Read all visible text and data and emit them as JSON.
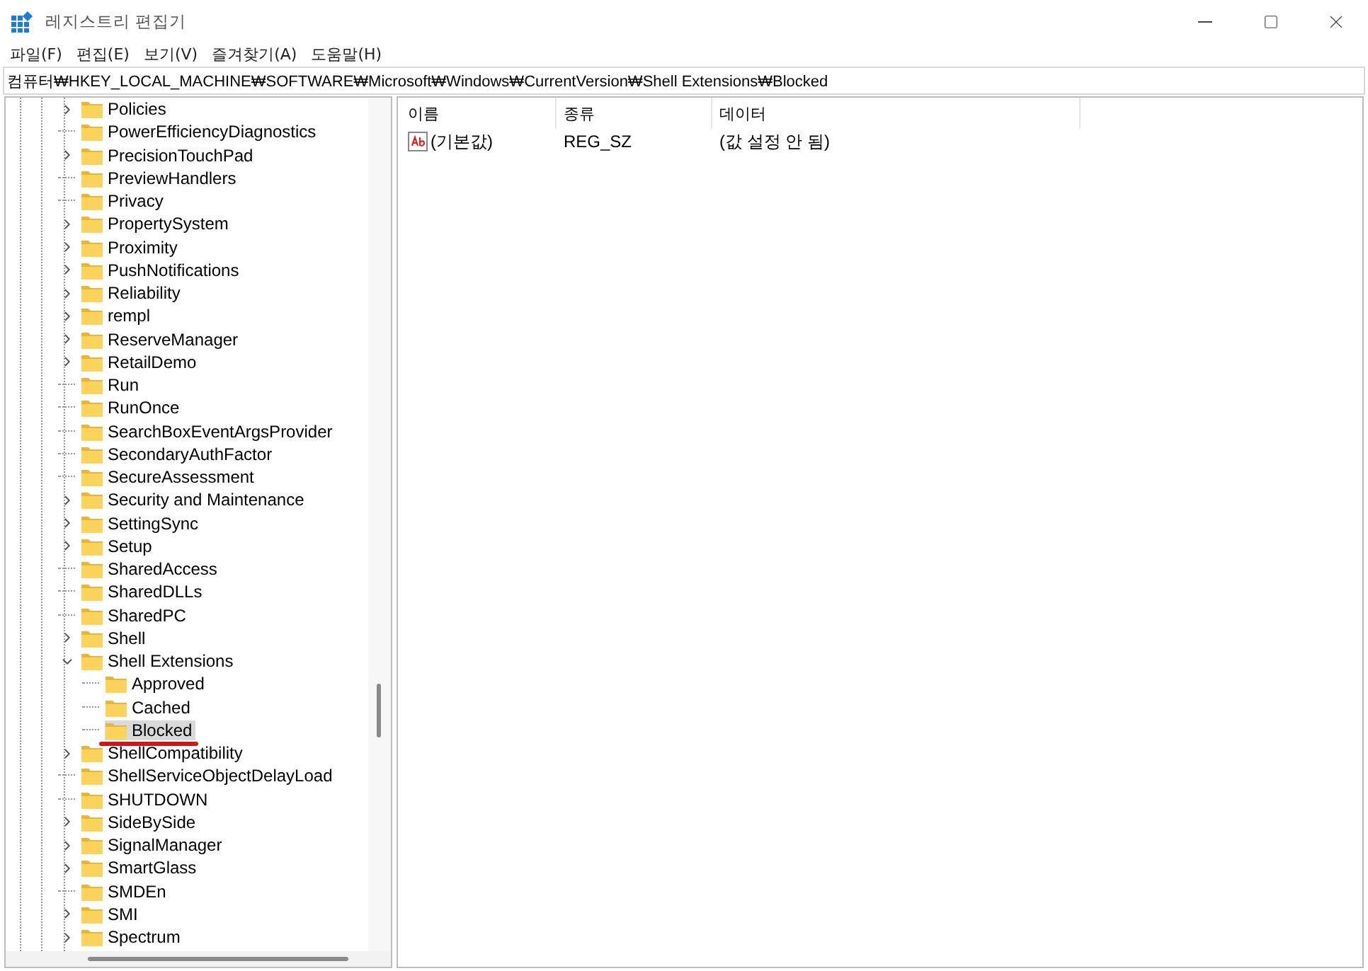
{
  "window": {
    "title": "레지스트리 편집기"
  },
  "menu": [
    "파일(F)",
    "편집(E)",
    "보기(V)",
    "즐겨찾기(A)",
    "도움말(H)"
  ],
  "address": "컴퓨터₩HKEY_LOCAL_MACHINE₩SOFTWARE₩Microsoft₩Windows₩CurrentVersion₩Shell Extensions₩Blocked",
  "tree": [
    {
      "label": "Policies",
      "kind": "branch",
      "expanded": false,
      "selected": false
    },
    {
      "label": "PowerEfficiencyDiagnostics",
      "kind": "leaf",
      "selected": false
    },
    {
      "label": "PrecisionTouchPad",
      "kind": "branch",
      "expanded": false,
      "selected": false
    },
    {
      "label": "PreviewHandlers",
      "kind": "leaf",
      "selected": false
    },
    {
      "label": "Privacy",
      "kind": "leaf",
      "selected": false
    },
    {
      "label": "PropertySystem",
      "kind": "branch",
      "expanded": false,
      "selected": false
    },
    {
      "label": "Proximity",
      "kind": "branch",
      "expanded": false,
      "selected": false
    },
    {
      "label": "PushNotifications",
      "kind": "branch",
      "expanded": false,
      "selected": false
    },
    {
      "label": "Reliability",
      "kind": "branch",
      "expanded": false,
      "selected": false
    },
    {
      "label": "rempl",
      "kind": "branch",
      "expanded": false,
      "selected": false
    },
    {
      "label": "ReserveManager",
      "kind": "branch",
      "expanded": false,
      "selected": false
    },
    {
      "label": "RetailDemo",
      "kind": "branch",
      "expanded": false,
      "selected": false
    },
    {
      "label": "Run",
      "kind": "leaf",
      "selected": false
    },
    {
      "label": "RunOnce",
      "kind": "leaf",
      "selected": false
    },
    {
      "label": "SearchBoxEventArgsProvider",
      "kind": "leaf",
      "selected": false
    },
    {
      "label": "SecondaryAuthFactor",
      "kind": "leaf",
      "selected": false
    },
    {
      "label": "SecureAssessment",
      "kind": "leaf",
      "selected": false
    },
    {
      "label": "Security and Maintenance",
      "kind": "branch",
      "expanded": false,
      "selected": false
    },
    {
      "label": "SettingSync",
      "kind": "branch",
      "expanded": false,
      "selected": false
    },
    {
      "label": "Setup",
      "kind": "branch",
      "expanded": false,
      "selected": false
    },
    {
      "label": "SharedAccess",
      "kind": "leaf",
      "selected": false
    },
    {
      "label": "SharedDLLs",
      "kind": "leaf",
      "selected": false
    },
    {
      "label": "SharedPC",
      "kind": "leaf",
      "selected": false
    },
    {
      "label": "Shell",
      "kind": "branch",
      "expanded": false,
      "selected": false
    },
    {
      "label": "Shell Extensions",
      "kind": "branch",
      "expanded": true,
      "selected": false,
      "children": [
        {
          "label": "Approved",
          "kind": "leaf",
          "selected": false
        },
        {
          "label": "Cached",
          "kind": "leaf",
          "selected": false
        },
        {
          "label": "Blocked",
          "kind": "leaf",
          "selected": true,
          "underlined": true
        }
      ]
    },
    {
      "label": "ShellCompatibility",
      "kind": "branch",
      "expanded": false,
      "selected": false
    },
    {
      "label": "ShellServiceObjectDelayLoad",
      "kind": "leaf",
      "selected": false
    },
    {
      "label": "SHUTDOWN",
      "kind": "leaf",
      "selected": false
    },
    {
      "label": "SideBySide",
      "kind": "branch",
      "expanded": false,
      "selected": false
    },
    {
      "label": "SignalManager",
      "kind": "branch",
      "expanded": false,
      "selected": false
    },
    {
      "label": "SmartGlass",
      "kind": "branch",
      "expanded": false,
      "selected": false
    },
    {
      "label": "SMDEn",
      "kind": "leaf",
      "selected": false
    },
    {
      "label": "SMI",
      "kind": "branch",
      "expanded": false,
      "selected": false
    },
    {
      "label": "Spectrum",
      "kind": "branch",
      "expanded": false,
      "selected": false
    }
  ],
  "table": {
    "columns": [
      "이름",
      "종류",
      "데이터"
    ],
    "rows": [
      {
        "name": "(기본값)",
        "type": "REG_SZ",
        "data": "(값 설정 안 됨)"
      }
    ]
  }
}
